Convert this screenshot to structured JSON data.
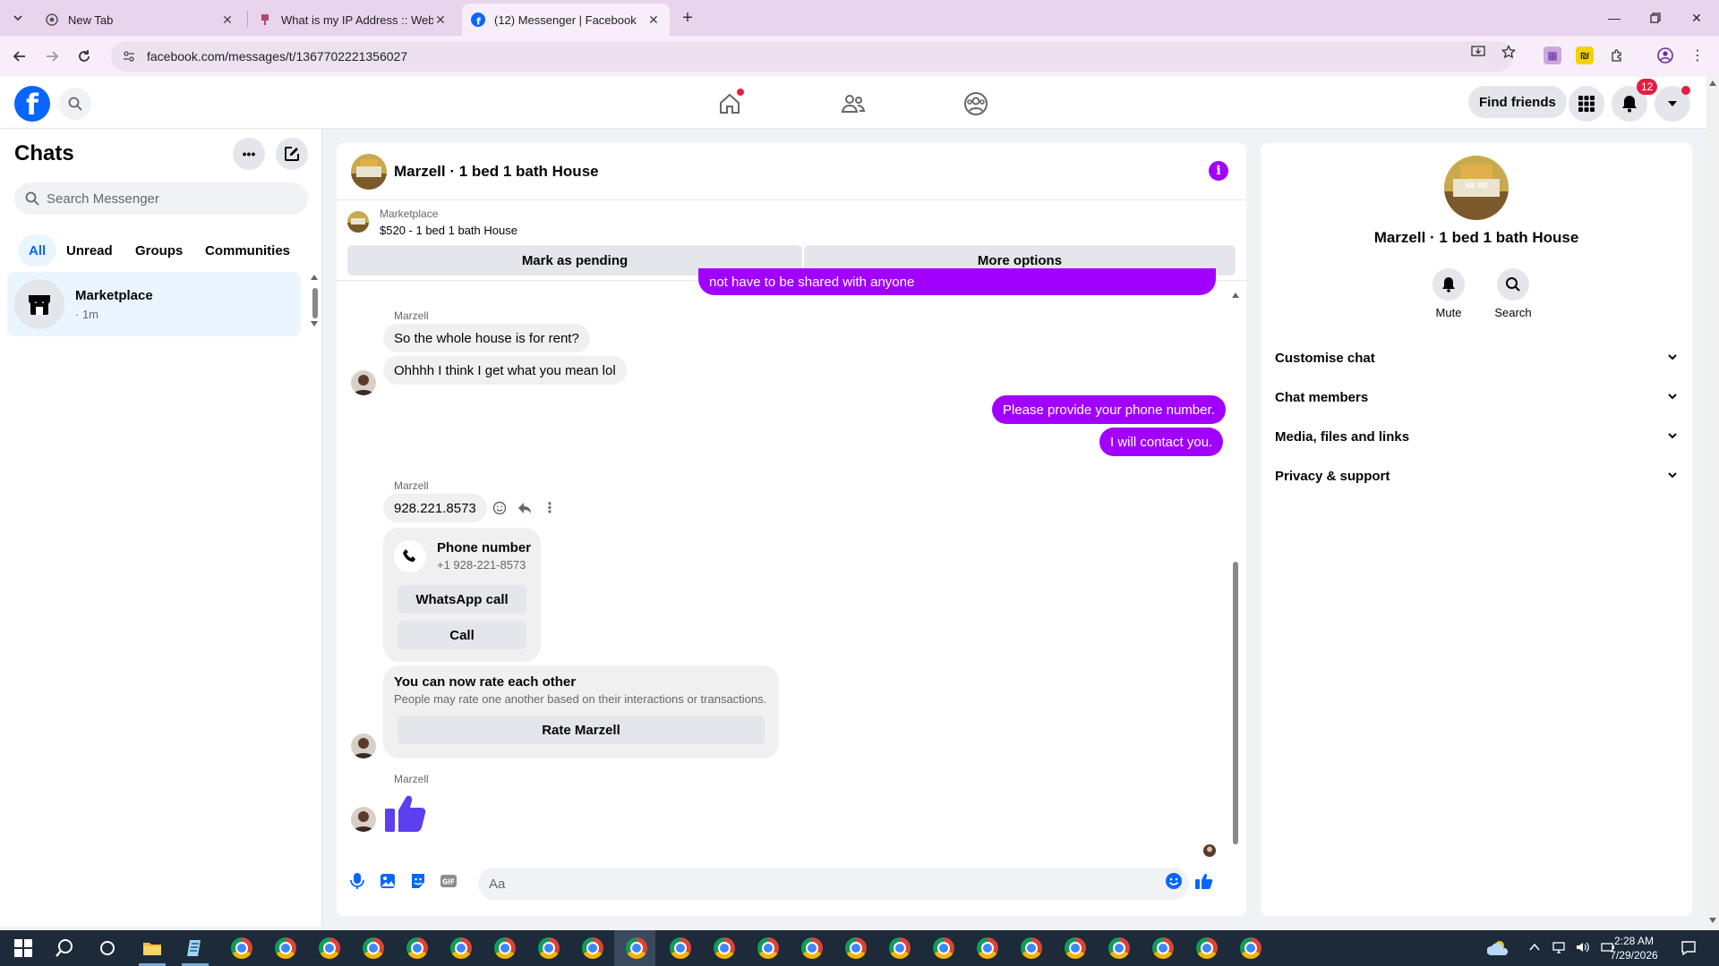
{
  "browser": {
    "tabs": [
      {
        "title": "New Tab"
      },
      {
        "title": "What is my IP Address :: WebB"
      },
      {
        "title": "(12) Messenger | Facebook"
      }
    ],
    "url": "facebook.com/messages/t/1367702221356027"
  },
  "fb_header": {
    "find_friends": "Find friends",
    "notification_count": "12"
  },
  "chats_panel": {
    "title": "Chats",
    "search_placeholder": "Search Messenger",
    "filters": [
      "All",
      "Unread",
      "Groups",
      "Communities"
    ],
    "items": [
      {
        "name": "Marketplace",
        "time": "· 1m"
      }
    ]
  },
  "conversation": {
    "title": "Marzell · 1 bed 1 bath House",
    "marketplace": {
      "label": "Marketplace",
      "listing": "$520 - 1 bed 1 bath House",
      "mark_pending": "Mark as pending",
      "more_options": "More options"
    },
    "messages": {
      "partial_out": "not have to be shared with anyone",
      "sender1": "Marzell",
      "in1": "So the whole house is for rent?",
      "in2": "Ohhhh I think I get what you mean lol",
      "out1": "Please provide your phone number.",
      "out2": "I will contact you.",
      "sender2": "Marzell",
      "in3": "928.221.8573",
      "phone_card": {
        "title": "Phone number",
        "number": "+1 928-221-8573",
        "whatsapp": "WhatsApp call",
        "call": "Call"
      },
      "rate_card": {
        "title": "You can now rate each other",
        "subtitle": "People may rate one another based on their interactions or transactions.",
        "button": "Rate Marzell"
      },
      "sender3": "Marzell"
    },
    "composer_placeholder": "Aa"
  },
  "info_panel": {
    "name": "Marzell · 1 bed 1 bath House",
    "actions": [
      "Mute",
      "Search"
    ],
    "sections": [
      "Customise chat",
      "Chat members",
      "Media, files and links",
      "Privacy & support"
    ]
  },
  "taskbar": {
    "time": "2:28 AM",
    "date": "7/29/2026"
  },
  "colors": {
    "accent_purple": "#a100ff",
    "fb_blue": "#0866ff",
    "selected_chat_bg": "#ebf5ff"
  }
}
